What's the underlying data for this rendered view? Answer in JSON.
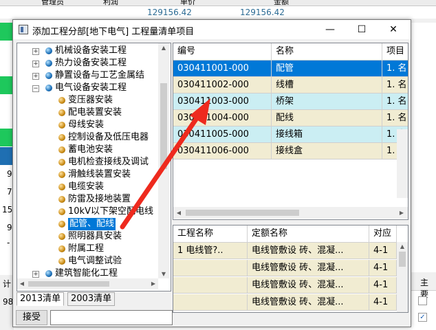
{
  "background": {
    "header_cols": [
      "管理员",
      "利润",
      "单价",
      "金额"
    ],
    "totals": [
      "129156.42",
      "129156.42"
    ],
    "left_col_fragments": [
      "9",
      "7",
      "15",
      "9",
      "-"
    ],
    "left_bottom": [
      "计",
      "98"
    ],
    "right_header": "主要"
  },
  "window": {
    "title": "添加工程分部[地下电气] 工程量清单项目",
    "minimize": "—",
    "maximize": "☐",
    "close": "✕"
  },
  "tree": {
    "items": [
      {
        "label": "机械设备安装工程",
        "level": 1,
        "type": "group",
        "expander": "+"
      },
      {
        "label": "热力设备安装工程",
        "level": 1,
        "type": "group",
        "expander": "+"
      },
      {
        "label": "静置设备与工艺金属结",
        "level": 1,
        "type": "group",
        "expander": "+"
      },
      {
        "label": "电气设备安装工程",
        "level": 1,
        "type": "group",
        "expander": "−"
      },
      {
        "label": "变压器安装",
        "level": 2,
        "type": "leaf"
      },
      {
        "label": "配电装置安装",
        "level": 2,
        "type": "leaf"
      },
      {
        "label": "母线安装",
        "level": 2,
        "type": "leaf"
      },
      {
        "label": "控制设备及低压电器",
        "level": 2,
        "type": "leaf"
      },
      {
        "label": "蓄电池安装",
        "level": 2,
        "type": "leaf"
      },
      {
        "label": "电机检查接线及调试",
        "level": 2,
        "type": "leaf"
      },
      {
        "label": "滑触线装置安装",
        "level": 2,
        "type": "leaf"
      },
      {
        "label": "电缆安装",
        "level": 2,
        "type": "leaf"
      },
      {
        "label": "防雷及接地装置",
        "level": 2,
        "type": "leaf"
      },
      {
        "label": "10kV以下架空配电线",
        "level": 2,
        "type": "leaf"
      },
      {
        "label": "配管、配线",
        "level": 2,
        "type": "leaf",
        "selected": true
      },
      {
        "label": "照明器具安装",
        "level": 2,
        "type": "leaf"
      },
      {
        "label": "附属工程",
        "level": 2,
        "type": "leaf"
      },
      {
        "label": "电气调整试验",
        "level": 2,
        "type": "leaf"
      },
      {
        "label": "建筑智能化工程",
        "level": 1,
        "type": "group",
        "expander": "+"
      }
    ]
  },
  "tabs": [
    "2013清单",
    "2003清单"
  ],
  "accept_button": "接受",
  "accept_input": "",
  "upper_grid": {
    "columns": [
      "编号",
      "名称",
      "项目"
    ],
    "rows": [
      {
        "code": "030411001-000",
        "name": "配管",
        "feature": "1. 名",
        "bg": "#0078d7",
        "fg": "#ffffff"
      },
      {
        "code": "030411002-000",
        "name": "线槽",
        "feature": "1. 名",
        "bg": "#f1ecd2",
        "fg": "#000000"
      },
      {
        "code": "030411003-000",
        "name": "桥架",
        "feature": "1. 名",
        "bg": "#cbeef3",
        "fg": "#000000"
      },
      {
        "code": "030411004-000",
        "name": "配线",
        "feature": "1. 名",
        "bg": "#f1ecd2",
        "fg": "#000000"
      },
      {
        "code": "030411005-000",
        "name": "接线箱",
        "feature": "1. 名",
        "bg": "#cbeef3",
        "fg": "#000000"
      },
      {
        "code": "030411006-000",
        "name": "接线盒",
        "feature": "1. 名",
        "bg": "#f1ecd2",
        "fg": "#000000"
      }
    ]
  },
  "lower_grid": {
    "columns": [
      "工程名称",
      "定额名称",
      "对应"
    ],
    "rows": [
      {
        "proj": "1 电线管?..",
        "quota": "电线管敷设 砖、混凝...",
        "corr": "4-1"
      },
      {
        "proj": "",
        "quota": "电线管敷设 砖、混凝...",
        "corr": "4-1"
      },
      {
        "proj": "",
        "quota": "电线管敷设 砖、混凝...",
        "corr": "4-1"
      },
      {
        "proj": "",
        "quota": "电线管敷设 砖、混凝...",
        "corr": "4-1"
      }
    ]
  },
  "colors": {
    "selection": "#0078d7",
    "row_yellow": "#f1ecd2",
    "row_cyan": "#cbeef3",
    "annotation_arrow": "#ee2a1e",
    "green_strip": "#1ec85c"
  }
}
